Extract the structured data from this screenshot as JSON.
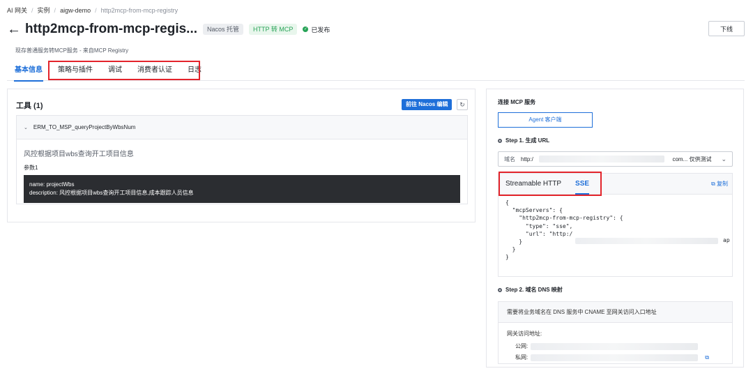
{
  "breadcrumb": [
    "AI 网关",
    "实例",
    "aigw-demo",
    "http2mcp-from-mcp-registry"
  ],
  "header": {
    "title": "http2mcp-from-mcp-regis...",
    "tag_nacos": "Nacos 托管",
    "tag_http": "HTTP 转 MCP",
    "status": "已发布",
    "offline_label": "下线",
    "subtitle": "现存普通服务转MCP服务 - 来自MCP Registry"
  },
  "tabs": [
    "基本信息",
    "策略与插件",
    "调试",
    "消费者认证",
    "日志"
  ],
  "tools": {
    "title": "工具 (1)",
    "goto_label": "前往 Nacos 编辑",
    "item_name": "ERM_TO_MSP_queryProjectByWbsNum",
    "item_desc": "风控根据项目wbs查询开工项目信息",
    "param_label": "参数1",
    "param_name": "name: projectWbs",
    "param_description": "description: 风控根据项目wbs查询开工项目信息,成本跟踪人员信息"
  },
  "connect": {
    "title": "连接 MCP 服务",
    "agent_label": "Agent 客户端",
    "step1": "Step 1. 生成 URL",
    "domain_label": "域名",
    "domain_prefix": "http:/",
    "domain_suffix": "com... 仅供测试",
    "code_tabs": [
      "Streamable HTTP",
      "SSE"
    ],
    "copy_label": "复制",
    "code": "{\n  \"mcpServers\": {\n    \"http2mcp-from-mcp-registry\": {\n      \"type\": \"sse\",\n      \"url\": \"http:/\n    }\n  }\n}",
    "code_url_tail": "ap",
    "step2": "Step 2. 域名 DNS 映射",
    "dns_desc": "需要将业务域名在 DNS 服务中 CNAME 至网关访问入口地址",
    "gateway_label": "网关访问地址:",
    "public_label": "公网:",
    "private_label": "私网:"
  },
  "colors": {
    "accent": "#1e6fd9",
    "highlight": "#e3242b",
    "success": "#27a357"
  }
}
